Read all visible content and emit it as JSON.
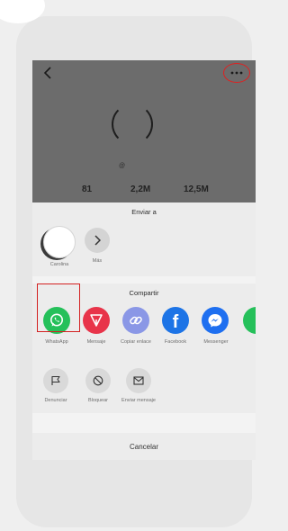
{
  "profile": {
    "handle": "@",
    "stats": [
      "81",
      "2,2M",
      "12,5M"
    ]
  },
  "send_to": {
    "title": "Enviar a",
    "contacts": [
      {
        "label": "Carolina"
      },
      {
        "label": "Más"
      }
    ]
  },
  "share": {
    "title": "Compartir",
    "apps": [
      {
        "label": "WhatsApp",
        "icon": "whatsapp-icon",
        "color": "#25c05a"
      },
      {
        "label": "Mensaje",
        "icon": "send-arrow-icon",
        "color": "#e8344a"
      },
      {
        "label": "Copiar enlace",
        "icon": "link-icon",
        "color": "#8a97e6"
      },
      {
        "label": "Facebook",
        "icon": "facebook-icon",
        "color": "#1d74e6"
      },
      {
        "label": "Messenger",
        "icon": "messenger-icon",
        "color": "#1e6ff0"
      }
    ],
    "actions": [
      {
        "label": "Denunciar",
        "icon": "flag-icon"
      },
      {
        "label": "Bloquear",
        "icon": "block-icon"
      },
      {
        "label": "Enviar mensaje",
        "icon": "envelope-icon"
      }
    ]
  },
  "cancel_label": "Cancelar",
  "colors": {
    "highlight": "#d32020",
    "profile_bg": "#6c6c6c",
    "sheet_bg": "#ececec"
  }
}
